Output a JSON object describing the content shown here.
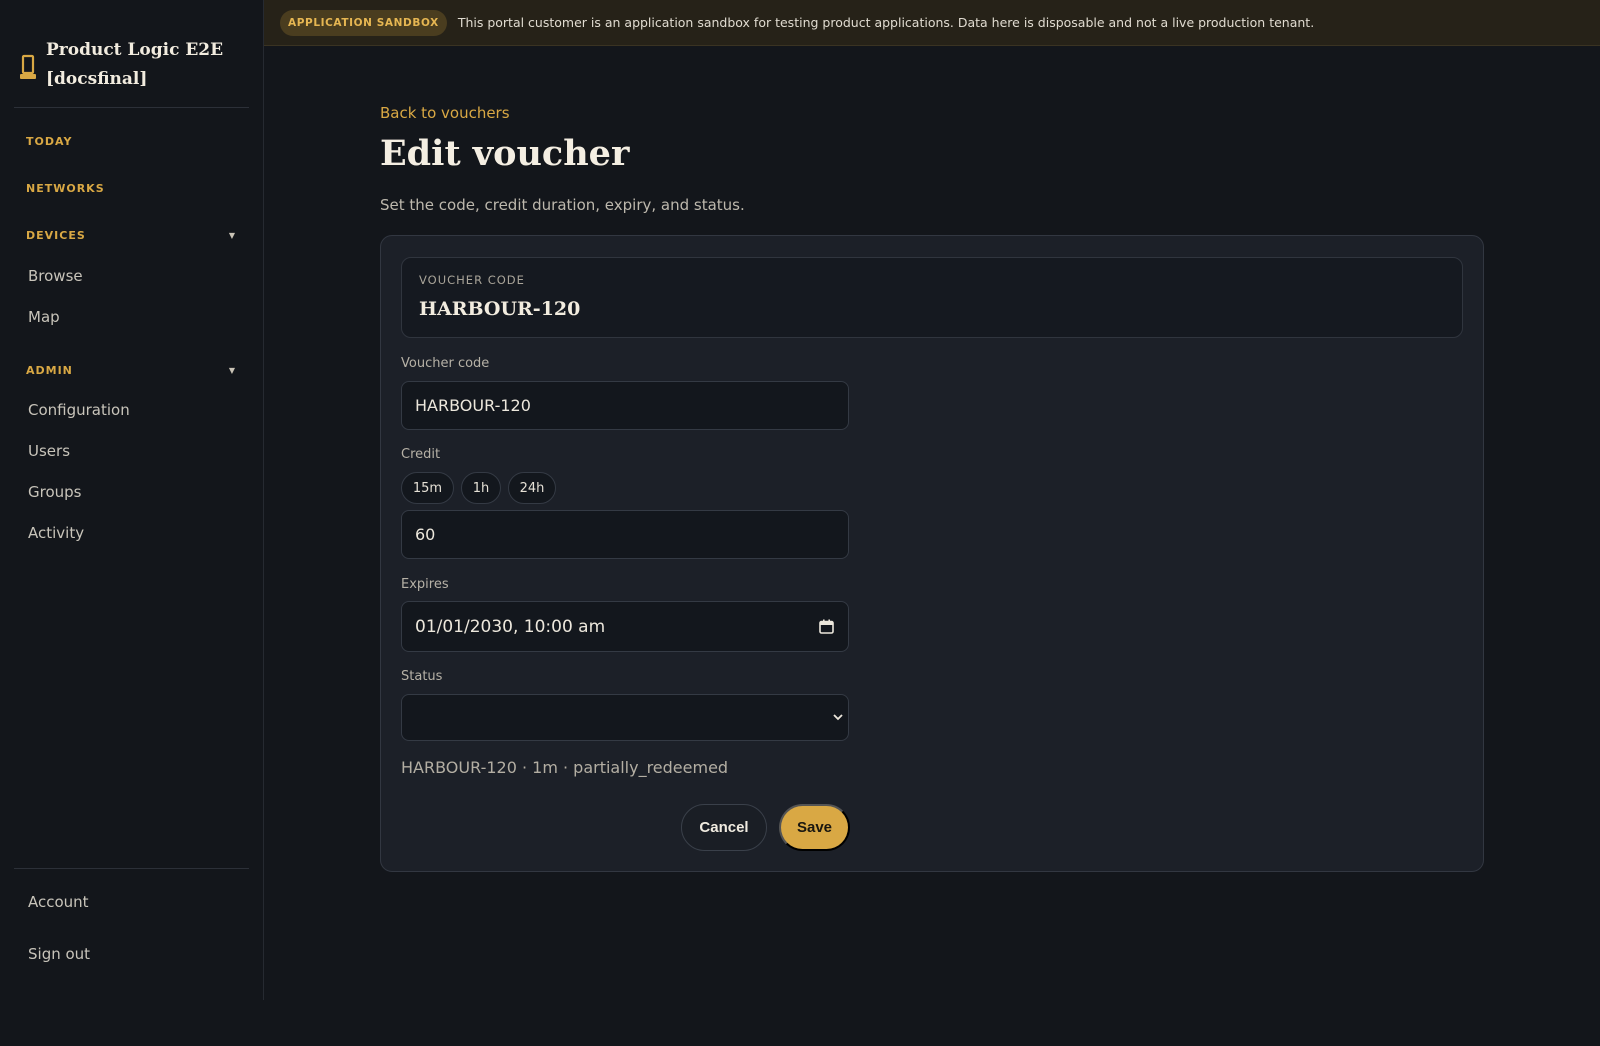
{
  "sidebar": {
    "brand_title": "Product Logic E2E [docsfinal]",
    "brand_icon": "tower-icon",
    "sections": {
      "today": "TODAY",
      "networks": "NETWORKS",
      "devices": "DEVICES",
      "admin": "ADMIN"
    },
    "items": {
      "browse": "Browse",
      "map": "Map",
      "configuration": "Configuration",
      "users": "Users",
      "groups": "Groups",
      "activity": "Activity",
      "account": "Account",
      "sign_out": "Sign out"
    }
  },
  "banner": {
    "badge": "APPLICATION SANDBOX",
    "text": "This portal customer is an application sandbox for testing product applications. Data here is disposable and not a live production tenant."
  },
  "page": {
    "back_link": "Back to vouchers",
    "title": "Edit voucher",
    "subtitle": "Set the code, credit duration, expiry, and status."
  },
  "form": {
    "code_panel_label": "VOUCHER CODE",
    "code_panel_value": "HARBOUR-120",
    "voucher_code_label": "Voucher code",
    "voucher_code_value": "HARBOUR-120",
    "credit_label": "Credit",
    "credit_presets": [
      "15m",
      "1h",
      "24h"
    ],
    "credit_value": "60",
    "expires_label": "Expires",
    "expires_value": "01/01/2030, 10:00 am",
    "status_label": "Status",
    "status_value": "",
    "summary": "HARBOUR-120 · 1m · partially_redeemed",
    "cancel_label": "Cancel",
    "save_label": "Save"
  },
  "colors": {
    "accent": "#d9a844",
    "background": "#13161b",
    "card": "#1c2028",
    "banner": "#262218"
  }
}
